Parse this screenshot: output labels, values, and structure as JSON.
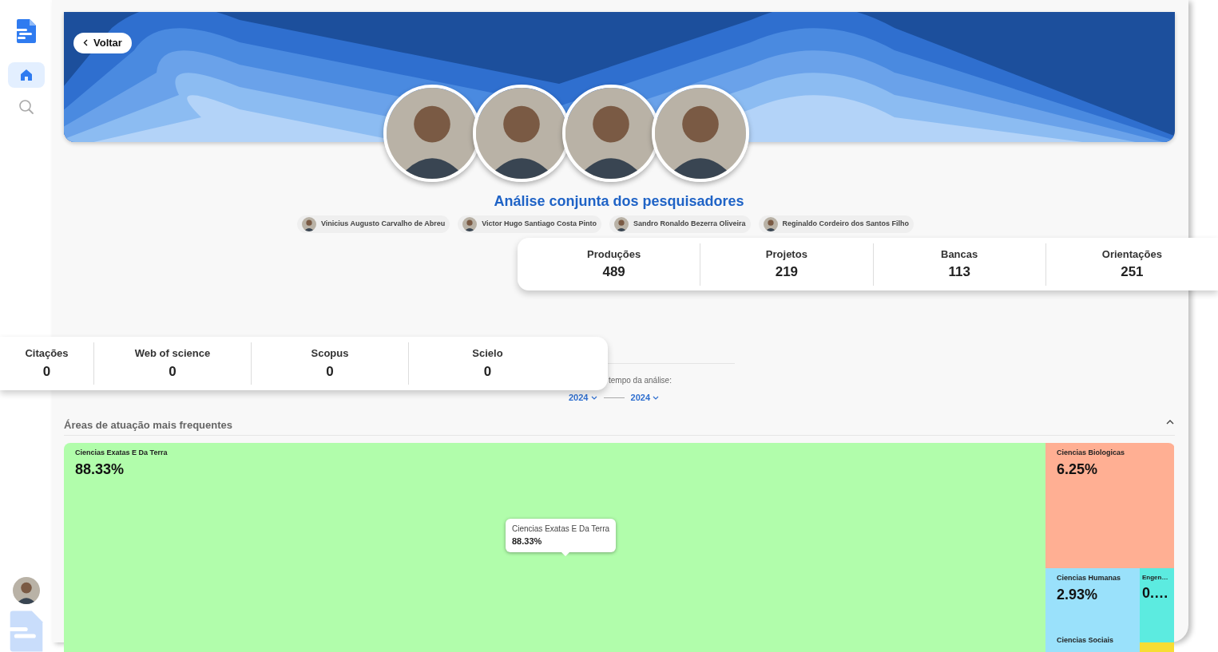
{
  "back_button": {
    "label": "Voltar"
  },
  "sidebar": {
    "items": [
      {
        "kind": "home",
        "selected": true
      },
      {
        "kind": "search",
        "selected": false
      }
    ]
  },
  "title": "Análise conjunta dos pesquisadores",
  "researchers": [
    {
      "name": "Vinicius Augusto Carvalho de Abreu"
    },
    {
      "name": "Victor Hugo Santiago Costa Pinto"
    },
    {
      "name": "Sandro Ronaldo Bezerra Oliveira"
    },
    {
      "name": "Reginaldo Cordeiro dos Santos Filho"
    }
  ],
  "stats": [
    {
      "label": "Produções",
      "value": "489"
    },
    {
      "label": "Projetos",
      "value": "219"
    },
    {
      "label": "Bancas",
      "value": "113"
    },
    {
      "label": "Orientações",
      "value": "251"
    }
  ],
  "citations": [
    {
      "label": "Citações",
      "value": "0"
    },
    {
      "label": "Web of science",
      "value": "0"
    },
    {
      "label": "Scopus",
      "value": "0"
    },
    {
      "label": "Scielo",
      "value": "0"
    }
  ],
  "period": {
    "label": "tempo da análise:",
    "from": "2024",
    "to": "2024"
  },
  "areas": {
    "title": "Áreas de atuação mais frequentes",
    "expanded": true,
    "tiles": [
      {
        "label": "Ciencias Exatas E Da Terra",
        "value": "88.33%",
        "color": "#b1fdab"
      },
      {
        "label": "Ciencias Biologicas",
        "value": "6.25%",
        "color": "#ffaf93"
      },
      {
        "label": "Ciencias Humanas",
        "value": "2.93%",
        "color": "#9ae1fb"
      },
      {
        "label": "Engen…",
        "value": "0.…",
        "color": "#5cebe0"
      },
      {
        "label": "Ciencias Sociais",
        "color": "#9ae1fb"
      },
      {
        "color": "#f7dd33"
      }
    ],
    "tooltip": {
      "label": "Ciencias Exatas E Da Terra",
      "value": "88.33%"
    }
  }
}
